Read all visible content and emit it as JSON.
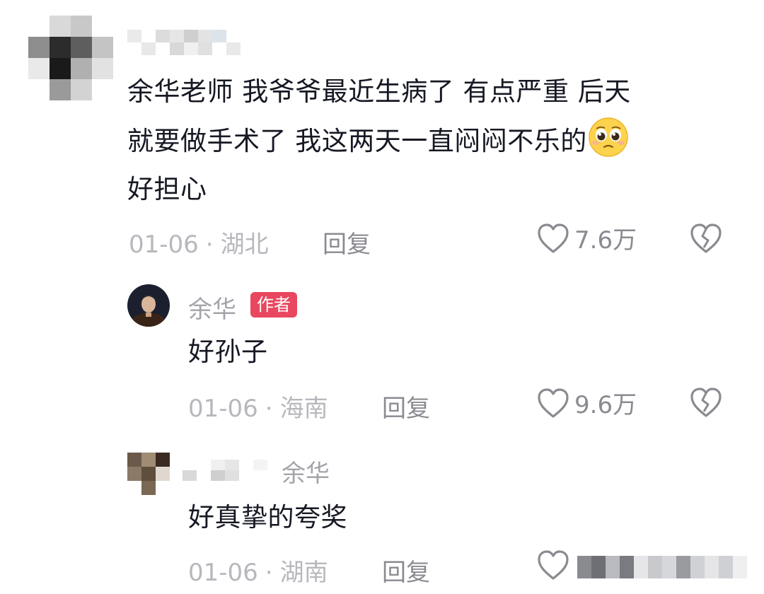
{
  "comments": [
    {
      "user": "",
      "text_lines": [
        "余华老师 我爷爷最近生病了 有点严重 后天",
        "就要做手术了 我这两天一直闷闷不乐的",
        "好担心"
      ],
      "emoji": "pleading-face-icon",
      "date": "01-06",
      "location": "湖北",
      "reply_label": "回复",
      "likes": "7.6万"
    }
  ],
  "replies": [
    {
      "user": "余华",
      "badge": "作者",
      "text": "好孙子",
      "date": "01-06",
      "location": "海南",
      "reply_label": "回复",
      "likes": "9.6万"
    },
    {
      "user": "",
      "reply_to": "余华",
      "text": "好真挚的夸奖",
      "date": "01-06",
      "location": "湖南",
      "reply_label": "回复",
      "likes": ""
    }
  ],
  "colors": {
    "accent_badge": "#e8475f",
    "meta_text": "#b7b8bd",
    "action_text": "#8a8b91"
  }
}
